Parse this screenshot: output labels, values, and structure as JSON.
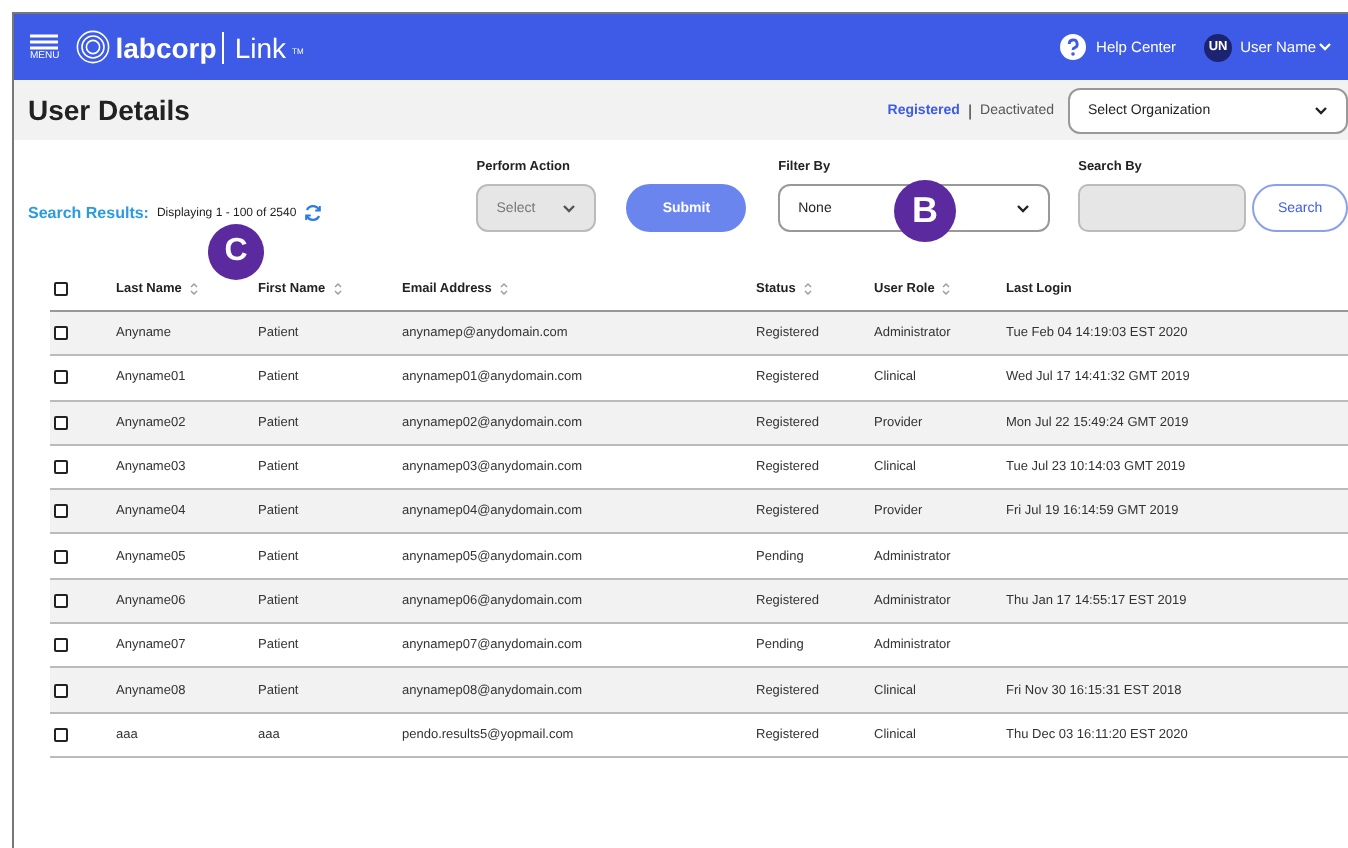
{
  "header": {
    "menu_label": "MENU",
    "logo": "labcorp",
    "product": "Link",
    "trademark": "TM",
    "help": "Help Center",
    "user_initials": "UN",
    "user_name": "User Name"
  },
  "page": {
    "title": "User Details",
    "status_links": [
      {
        "label": "Registered",
        "selected": true
      },
      {
        "label": "Deactivated",
        "selected": false
      }
    ],
    "status_separator": "|",
    "organization_select": {
      "placeholder": "Select Organization"
    }
  },
  "toolbar": {
    "results_label": "Search Results:",
    "displaying": "Displaying 1 - 100 of 2540",
    "perform_action": {
      "label": "Perform Action",
      "value": "Select",
      "disabled": true
    },
    "submit": "Submit",
    "filter_by": {
      "label": "Filter By",
      "value": "None"
    },
    "search_by": {
      "label": "Search By"
    },
    "search_button": "Search"
  },
  "table": {
    "select_all_checked": false,
    "columns": [
      {
        "label": "Last Name",
        "sortable": true
      },
      {
        "label": "First Name",
        "sortable": true
      },
      {
        "label": "Email Address",
        "sortable": true
      },
      {
        "label": "Status",
        "sortable": true
      },
      {
        "label": "User Role",
        "sortable": true
      },
      {
        "label": "Last Login",
        "sortable": false
      }
    ],
    "rows": [
      {
        "checked": false,
        "cells": [
          "Anyname",
          "Patient",
          "anynamep@anydomain.com",
          "Registered",
          "Administrator",
          "Tue Feb 04 14:19:03 EST 2020"
        ]
      },
      {
        "checked": false,
        "cells": [
          "Anyname01",
          "Patient",
          "anynamep01@anydomain.com",
          "Registered",
          "Clinical",
          "Wed Jul 17 14:41:32 GMT 2019"
        ]
      },
      {
        "checked": false,
        "cells": [
          "Anyname02",
          "Patient",
          "anynamep02@anydomain.com",
          "Registered",
          "Provider",
          "Mon Jul 22 15:49:24 GMT 2019"
        ]
      },
      {
        "checked": false,
        "cells": [
          "Anyname03",
          "Patient",
          "anynamep03@anydomain.com",
          "Registered",
          "Clinical",
          "Tue Jul 23 10:14:03 GMT 2019"
        ]
      },
      {
        "checked": false,
        "cells": [
          "Anyname04",
          "Patient",
          "anynamep04@anydomain.com",
          "Registered",
          "Provider",
          "Fri Jul 19 16:14:59 GMT 2019"
        ]
      },
      {
        "checked": false,
        "cells": [
          "Anyname05",
          "Patient",
          "anynamep05@anydomain.com",
          "Pending",
          "Administrator",
          null
        ]
      },
      {
        "checked": false,
        "cells": [
          "Anyname06",
          "Patient",
          "anynamep06@anydomain.com",
          "Registered",
          "Administrator",
          "Thu Jan 17 14:55:17 EST 2019"
        ]
      },
      {
        "checked": false,
        "cells": [
          "Anyname07",
          "Patient",
          "anynamep07@anydomain.com",
          "Pending",
          "Administrator",
          null
        ]
      },
      {
        "checked": false,
        "cells": [
          "Anyname08",
          "Patient",
          "anynamep08@anydomain.com",
          "Registered",
          "Clinical",
          "Fri Nov 30 16:15:31 EST 2018"
        ]
      },
      {
        "checked": false,
        "cells": [
          "aaa",
          "aaa",
          "pendo.results5@yopmail.com",
          "Registered",
          "Clinical",
          "Thu Dec 03 16:11:20 EST 2020"
        ]
      }
    ]
  },
  "callouts": [
    {
      "label": "B"
    },
    {
      "label": "C"
    }
  ]
}
